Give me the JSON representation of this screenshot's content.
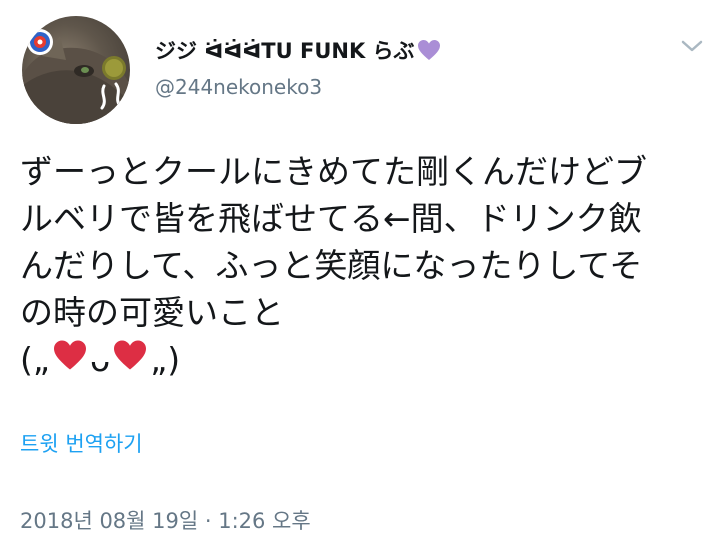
{
  "tweet": {
    "display_name": "ジジ ᐛᐛᐛTU FUNK らぶ",
    "name_emoji_icon": "purple-heart-icon",
    "handle": "@244nekoneko3",
    "menu_icon": "chevron-down-icon",
    "body_lines": [
      "ずーっとクールにきめてた剛くんだけどブ",
      "ルベリで皆を飛ばせてる←間、ドリンク飲",
      "んだりして、ふっと笑顔になったりしてそ",
      "の時の可愛いこと"
    ],
    "emoticon": {
      "open": "(",
      "left_marks": "„",
      "mouth": "ᴗ",
      "right_marks": "„",
      "close": ")",
      "heart_icon": "red-heart-icon"
    },
    "translate_label": "트윗 번역하기",
    "timestamp": "2018년 08월 19일 · 1:26 오후"
  },
  "colors": {
    "text": "#14171a",
    "secondary": "#657786",
    "link": "#1da1f2",
    "red_heart": "#dd2e44",
    "purple_heart": "#aa8ed6"
  }
}
